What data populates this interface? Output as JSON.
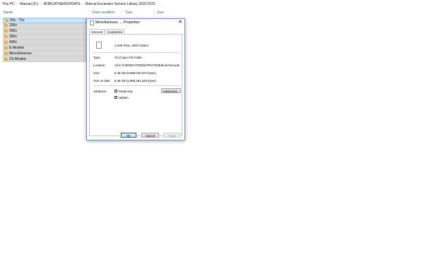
{
  "breadcrumb": [
    "This PC",
    "Manual (D:)",
    "BOBCATNEWUPDATE",
    "Bobcat Excavator Service Library 2020 DVD"
  ],
  "columns": {
    "name": "Name",
    "date": "Date modified",
    "type": "Type",
    "size": "Size"
  },
  "files": [
    "50s - 70s",
    "100s",
    "200s",
    "300s",
    "400s",
    "E-Models",
    "Miscellaneous",
    "ZX-Models"
  ],
  "dialog": {
    "title": "Miscellaneous, ... Properties",
    "close_label": "✕",
    "tabs": [
      "General",
      "Customize"
    ],
    "files_summary": "1,209 Files, 288 Folders",
    "properties": {
      "type_label": "Type:",
      "type_value": "All of type File folder",
      "location_label": "Location:",
      "location_value": "All in D:\\BOBCATNEWUPDATE\\Bobcat Excavator Se",
      "size_label": "Size:",
      "size_value": "5.48 GB (5,888,032,870 bytes)",
      "size_on_disk_label": "Size on disk:",
      "size_on_disk_value": "5.48 GB (5,888,491,520 bytes)"
    },
    "attributes": {
      "label": "Attributes:",
      "readonly_label": "Read-only",
      "hidden_label": "Hidden",
      "advanced_label": "Advanced..."
    },
    "buttons": {
      "ok": "OK",
      "cancel": "Cancel",
      "apply": "Apply"
    }
  }
}
